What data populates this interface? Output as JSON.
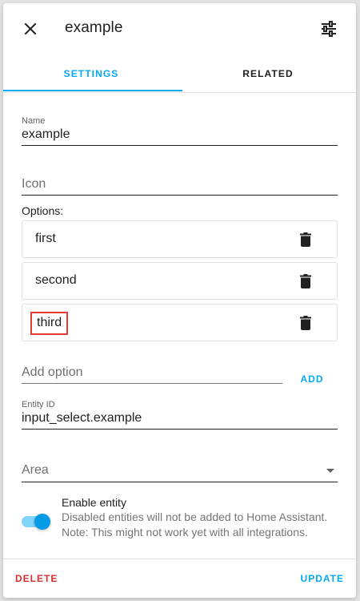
{
  "header": {
    "title": "example",
    "close_icon": "close-icon",
    "settings_icon": "tune-icon"
  },
  "tabs": [
    {
      "label": "SETTINGS",
      "active": true
    },
    {
      "label": "RELATED",
      "active": false
    }
  ],
  "form": {
    "name": {
      "label": "Name",
      "value": "example"
    },
    "icon": {
      "placeholder": "Icon"
    },
    "options_label": "Options:",
    "options": [
      {
        "text": "first"
      },
      {
        "text": "second"
      },
      {
        "text": "third"
      }
    ],
    "add_option": {
      "placeholder": "Add option",
      "button_label": "ADD"
    },
    "entity_id": {
      "label": "Entity ID",
      "value": "input_select.example"
    },
    "area": {
      "placeholder": "Area"
    },
    "enable_entity": {
      "title": "Enable entity",
      "description": "Disabled entities will not be added to Home Assistant. Note: This might not work yet with all integrations.",
      "enabled": true
    }
  },
  "footer": {
    "delete_label": "DELETE",
    "update_label": "UPDATE"
  },
  "colors": {
    "accent": "#03a9f4",
    "danger": "#d32f2f",
    "highlight_box": "#e53935"
  }
}
